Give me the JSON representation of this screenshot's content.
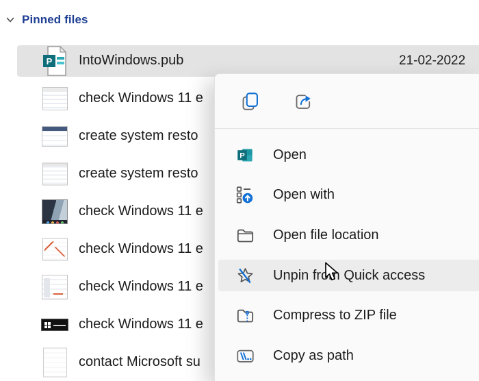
{
  "colors": {
    "accent_blue": "#1270d6",
    "header_blue": "#1f3f94",
    "publisher_teal_dark": "#0e6f7a",
    "publisher_teal_light": "#2aa7b3",
    "selected_row_bg": "#e3e3e3",
    "menu_bg": "#fafafa",
    "menu_hover_bg": "#ececec"
  },
  "header": {
    "title": "Pinned files"
  },
  "files": [
    {
      "name": "IntoWindows.pub",
      "date": "21-02-2022",
      "selected": true,
      "icon": "publisher-document"
    },
    {
      "name": "check Windows 11 e",
      "icon": "screenshot-thumbnail"
    },
    {
      "name": "create system resto",
      "icon": "screenshot-thumbnail"
    },
    {
      "name": "create system resto",
      "icon": "screenshot-thumbnail"
    },
    {
      "name": "check Windows 11 e",
      "icon": "screenshot-thumbnail"
    },
    {
      "name": "check Windows 11 e",
      "icon": "screenshot-thumbnail"
    },
    {
      "name": "check Windows 11 e",
      "icon": "screenshot-thumbnail"
    },
    {
      "name": "check Windows 11 e",
      "icon": "windows-logo-thumbnail"
    },
    {
      "name": "contact Microsoft su",
      "icon": "document-thumbnail"
    }
  ],
  "context_menu": {
    "quick_actions": [
      {
        "name": "copy",
        "icon": "copy-icon"
      },
      {
        "name": "share",
        "icon": "share-icon"
      }
    ],
    "items": [
      {
        "label": "Open",
        "icon": "publisher-app-icon",
        "hovered": false
      },
      {
        "label": "Open with",
        "icon": "open-with-icon",
        "hovered": false
      },
      {
        "label": "Open file location",
        "icon": "folder-icon",
        "hovered": false
      },
      {
        "label": "Unpin from Quick access",
        "icon": "unpin-star-icon",
        "hovered": true
      },
      {
        "label": "Compress to ZIP file",
        "icon": "zip-folder-icon",
        "hovered": false
      },
      {
        "label": "Copy as path",
        "icon": "copy-path-icon",
        "hovered": false
      }
    ]
  }
}
